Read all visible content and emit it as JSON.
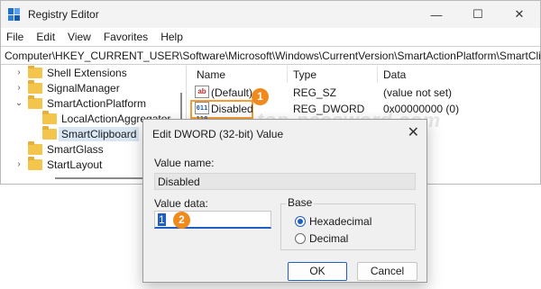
{
  "window": {
    "title": "Registry Editor",
    "controls": {
      "minimize": "—",
      "maximize": "☐",
      "close": "✕"
    }
  },
  "menu": [
    "File",
    "Edit",
    "View",
    "Favorites",
    "Help"
  ],
  "address": "Computer\\HKEY_CURRENT_USER\\Software\\Microsoft\\Windows\\CurrentVersion\\SmartActionPlatform\\SmartClipboard",
  "tree": {
    "items": [
      {
        "label": "Shell Extensions",
        "chevron": "›"
      },
      {
        "label": "SignalManager",
        "chevron": "›"
      },
      {
        "label": "SmartActionPlatform",
        "chevron": "⌄"
      },
      {
        "label": "LocalActionAggregator",
        "chevron": ""
      },
      {
        "label": "SmartClipboard",
        "chevron": ""
      },
      {
        "label": "SmartGlass",
        "chevron": ""
      },
      {
        "label": "StartLayout",
        "chevron": "›"
      }
    ]
  },
  "list": {
    "columns": [
      "Name",
      "Type",
      "Data"
    ],
    "rows": [
      {
        "icon": "ab",
        "name": "(Default)",
        "type": "REG_SZ",
        "data": "(value not set)"
      },
      {
        "icon": "011 110",
        "name": "Disabled",
        "type": "REG_DWORD",
        "data": "0x00000000 (0)"
      }
    ]
  },
  "badges": {
    "one": "1",
    "two": "2"
  },
  "watermark": "top-password.com",
  "dialog": {
    "title": "Edit DWORD (32-bit) Value",
    "close": "✕",
    "value_name_label": "Value name:",
    "value_name": "Disabled",
    "value_data_label": "Value data:",
    "value_data": "1",
    "base_label": "Base",
    "base_options": [
      "Hexadecimal",
      "Decimal"
    ],
    "base_selected": "Hexadecimal",
    "ok": "OK",
    "cancel": "Cancel"
  },
  "colors": {
    "accent": "#1f5fbf",
    "badge": "#f08a1c",
    "highlight_box": "#f39c33"
  }
}
